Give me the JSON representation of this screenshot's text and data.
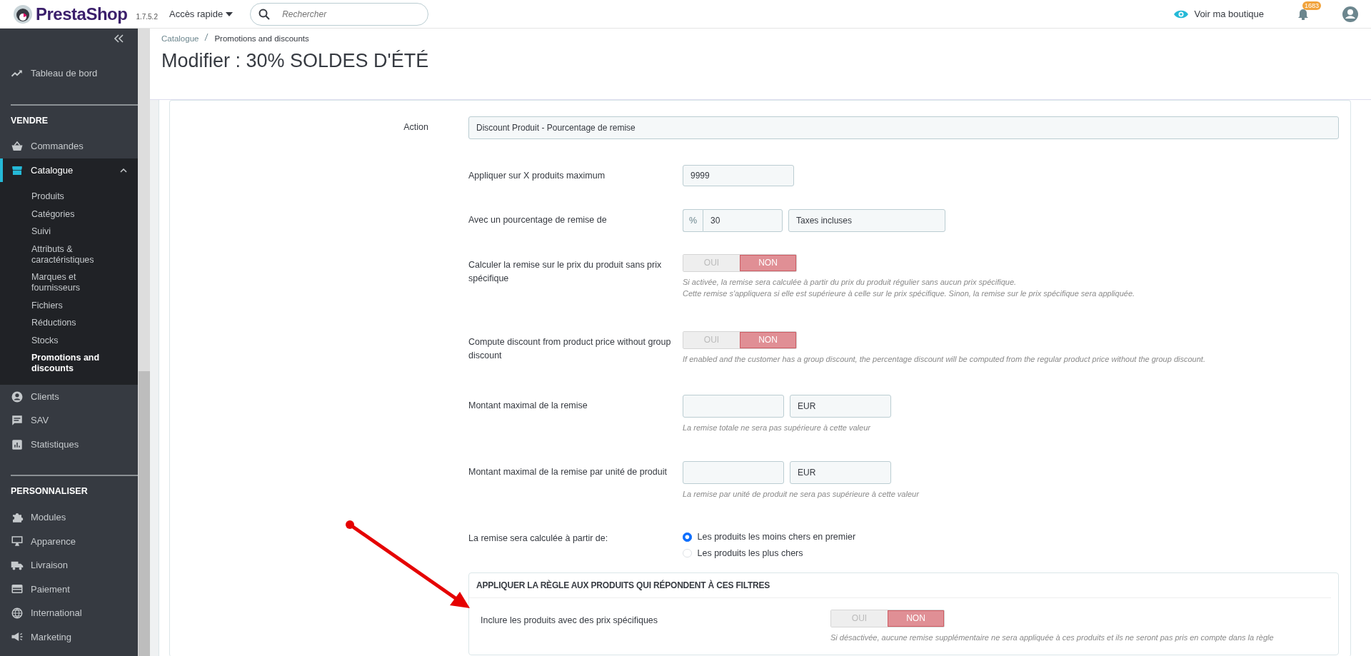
{
  "header": {
    "logo": "PrestaShop",
    "version": "1.7.5.2",
    "quick_access": "Accès rapide",
    "search": {
      "placeholder": "Rechercher"
    },
    "shop_link": "Voir ma boutique",
    "notifications": "1683"
  },
  "sidebar": {
    "sections": [
      {
        "items": [
          {
            "label": "Tableau de bord",
            "selected": false
          }
        ]
      },
      {
        "heading": "VENDRE",
        "items": [
          {
            "label": "Commandes",
            "selected": false
          },
          {
            "label": "Catalogue",
            "selected": true,
            "expanded": true,
            "children": [
              {
                "label": "Produits",
                "selected": false
              },
              {
                "label": "Catégories",
                "selected": false
              },
              {
                "label": "Suivi",
                "selected": false
              },
              {
                "label": "Attributs & caractéristiques",
                "selected": false
              },
              {
                "label": "Marques et fournisseurs",
                "selected": false
              },
              {
                "label": "Fichiers",
                "selected": false
              },
              {
                "label": "Réductions",
                "selected": false
              },
              {
                "label": "Stocks",
                "selected": false
              },
              {
                "label": "Promotions and discounts",
                "selected": true
              }
            ]
          },
          {
            "label": "Clients",
            "selected": false
          },
          {
            "label": "SAV",
            "selected": false
          },
          {
            "label": "Statistiques",
            "selected": false
          }
        ]
      },
      {
        "heading": "PERSONNALISER",
        "items": [
          {
            "label": "Modules",
            "selected": false
          },
          {
            "label": "Apparence",
            "selected": false
          },
          {
            "label": "Livraison",
            "selected": false
          },
          {
            "label": "Paiement",
            "selected": false
          },
          {
            "label": "International",
            "selected": false
          },
          {
            "label": "Marketing",
            "selected": false
          }
        ]
      }
    ]
  },
  "breadcrumb": [
    "Catalogue",
    "Promotions and discounts"
  ],
  "title": "Modifier : 30% SOLDES D'ÉTÉ",
  "form": {
    "action": {
      "label": "Action",
      "value": "Discount Produit - Pourcentage de remise"
    },
    "rows": [
      {
        "kind": "input",
        "label": "Appliquer sur X produits maximum",
        "value": "9999"
      },
      {
        "kind": "percent",
        "label": "Avec un pourcentage de remise de",
        "prefix": "%",
        "value": "30",
        "select": "Taxes incluses"
      },
      {
        "kind": "toggle",
        "label": "Calculer la remise sur le prix du produit sans prix spécifique",
        "yes": "OUI",
        "no": "NON",
        "on": false,
        "help": [
          "Si activée, la remise sera calculée à partir du prix du produit régulier sans aucun prix spécifique.",
          "Cette remise s'appliquera si elle est supérieure à celle sur le prix spécifique. Sinon, la remise sur le prix spécifique sera appliquée."
        ]
      },
      {
        "kind": "toggle",
        "label": "Compute discount from product price without group discount",
        "yes": "OUI",
        "no": "NON",
        "on": false,
        "help": [
          "If enabled and the customer has a group discount, the percentage discount will be computed from the regular product price without the group discount."
        ]
      },
      {
        "kind": "money",
        "label": "Montant maximal de la remise",
        "select": "EUR",
        "help": [
          "La remise totale ne sera pas supérieure à cette valeur"
        ]
      },
      {
        "kind": "money",
        "label": "Montant maximal de la remise par unité de produit",
        "select": "EUR",
        "help": [
          "La remise par unité de produit ne sera pas supérieure à cette valeur"
        ]
      },
      {
        "kind": "radio",
        "label": "La remise sera calculée à partir de:",
        "options": [
          {
            "label": "Les produits les moins chers en premier",
            "selected": true
          },
          {
            "label": "Les produits les plus chers",
            "selected": false
          }
        ]
      }
    ],
    "filters": {
      "title": "APPLIQUER LA RÈGLE AUX PRODUITS QUI RÉPONDENT À CES FILTRES",
      "rows": [
        {
          "kind": "toggle",
          "label": "Inclure les produits avec des prix spécifiques",
          "yes": "OUI",
          "no": "NON",
          "on": false,
          "help": [
            "Si désactivée, aucune remise supplémentaire ne sera appliquée à ces produits et ils ne seront pas pris en compte dans la règle"
          ]
        }
      ]
    }
  }
}
